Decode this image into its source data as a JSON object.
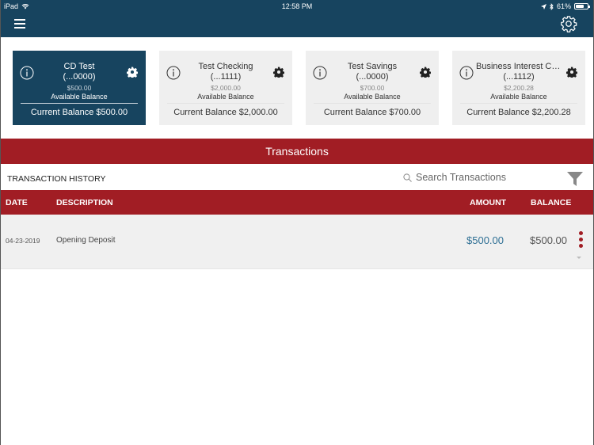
{
  "status_bar": {
    "device": "iPad",
    "time": "12:58 PM",
    "battery": "61%",
    "battery_level": 0.61
  },
  "header": {
    "menu_icon": "hamburger-icon",
    "settings_icon": "gear-icon"
  },
  "accounts": [
    {
      "name": "CD Test",
      "account": "(...0000)",
      "available_amount": "$500.00",
      "available_label": "Available Balance",
      "current_balance": "Current Balance $500.00",
      "selected": true
    },
    {
      "name": "Test Checking",
      "account": "(...1111)",
      "available_amount": "$2,000.00",
      "available_label": "Available Balance",
      "current_balance": "Current Balance $2,000.00",
      "selected": false
    },
    {
      "name": "Test Savings",
      "account": "(...0000)",
      "available_amount": "$700.00",
      "available_label": "Available Balance",
      "current_balance": "Current Balance $700.00",
      "selected": false
    },
    {
      "name": "Business Interest Ch...",
      "account": "(...1112)",
      "available_amount": "$2,200.28",
      "available_label": "Available Balance",
      "current_balance": "Current Balance $2,200.28",
      "selected": false
    }
  ],
  "section": {
    "title": "Transactions",
    "history_title": "TRANSACTION HISTORY",
    "search_placeholder": "Search Transactions"
  },
  "table": {
    "columns": {
      "date": "DATE",
      "description": "DESCRIPTION",
      "amount": "AMOUNT",
      "balance": "BALANCE"
    },
    "rows": [
      {
        "date": "04-23-2019",
        "description": "Opening Deposit",
        "amount": "$500.00",
        "balance": "$500.00"
      }
    ]
  },
  "colors": {
    "header_bg": "#17445f",
    "accent_red": "#a11d24",
    "amount_blue": "#2e6f94",
    "card_bg": "#efefef"
  }
}
